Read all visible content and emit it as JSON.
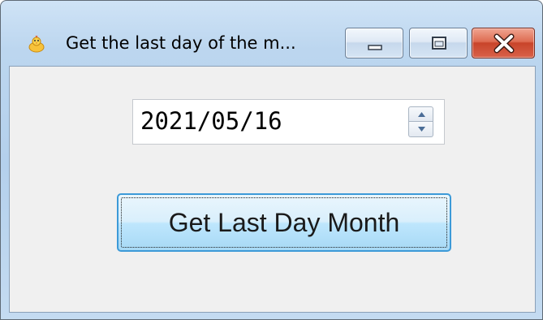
{
  "window": {
    "title": "Get the last day of the m...",
    "icon": "app-chick-icon",
    "controls": {
      "minimize": "minimize-icon",
      "maximize": "maximize-icon",
      "close": "close-icon"
    }
  },
  "form": {
    "date_value": "2021/05/16",
    "button_label": "Get Last Day Month"
  },
  "colors": {
    "client_background": "#f0f0f0",
    "button_border_focus": "#3c9ad8",
    "close_button": "#c8442a",
    "titlebar": "#bcd6ef"
  }
}
